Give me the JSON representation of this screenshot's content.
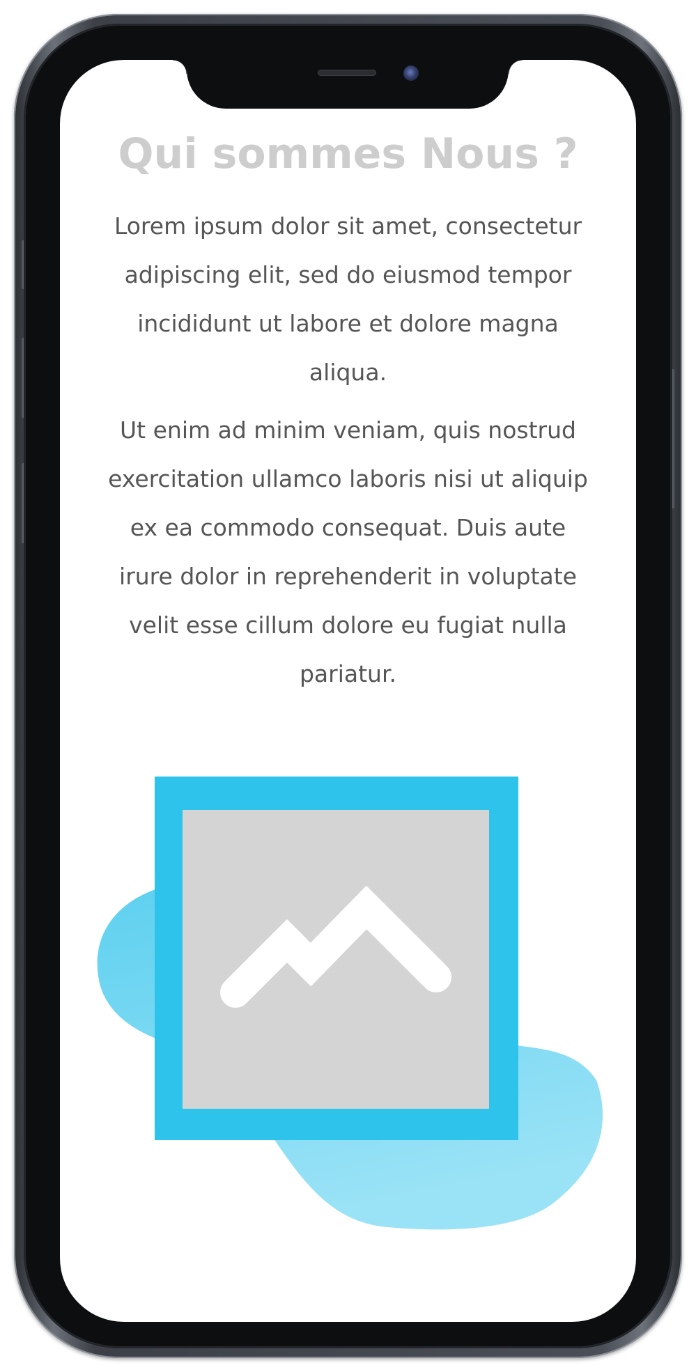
{
  "page": {
    "title": "Qui sommes Nous ?",
    "paragraphs": [
      "Lorem ipsum dolor sit amet, consectetur adipiscing elit, sed do eiusmod tempor incididunt ut labore et dolore magna aliqua.",
      "Ut enim ad minim veniam, quis nostrud exercitation ullamco laboris nisi ut aliquip ex ea commodo consequat. Duis aute irure dolor in reprehenderit in voluptate velit esse cillum dolore eu fugiat nulla pariatur."
    ]
  },
  "icons": {
    "placeholder": "mountain-image-icon",
    "camera": "front-camera-icon",
    "speaker": "earpiece-speaker-icon"
  },
  "colors": {
    "title": "#cdcdcd",
    "text": "#555555",
    "accent": "#2dc3ea",
    "blob": "#5dd3f0",
    "placeholder_bg": "#d4d4d4",
    "phone_frame": "#3d4047"
  }
}
